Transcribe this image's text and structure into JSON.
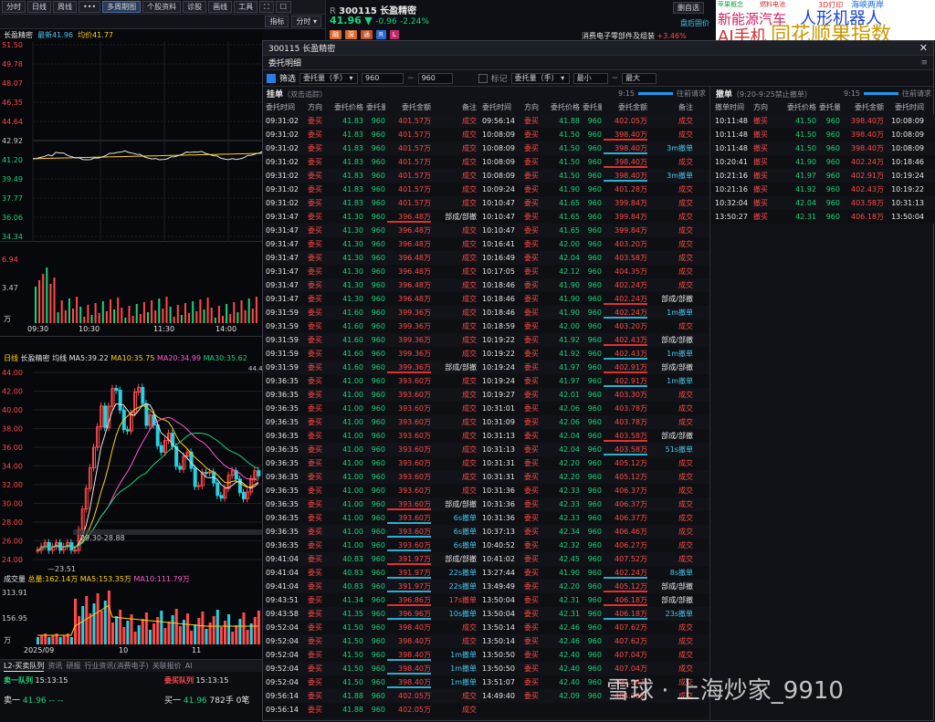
{
  "toolbar": {
    "items": [
      "分时",
      "日线",
      "周线",
      "•••",
      "多周期图",
      "个股资料",
      "诊股",
      "画线",
      "工具",
      "⛶",
      "☐"
    ],
    "row2": [
      "指标",
      "分时"
    ]
  },
  "quote": {
    "prefix": "R",
    "code": "300115",
    "name": "长盈精密",
    "price": "41.96",
    "change": "-0.96",
    "pct": "-2.24%",
    "btn1": "删自选",
    "btn2": "盘后固价",
    "sector_text": "消费电子零部件及组装",
    "sector_pct": "+3.46%",
    "tags": [
      "融",
      "深",
      "通",
      "R",
      "L"
    ]
  },
  "themes": {
    "items": [
      "苹果概念",
      "燃料电池",
      "3D打印",
      "海峡两岸",
      "新能源汽车",
      "人形机器人",
      "AI手机",
      "同花顺果指数"
    ],
    "colors": [
      "#1ba34b",
      "#d72c2c",
      "#d72c2c",
      "#1a6dd8",
      "#cc2266",
      "#1a44cc",
      "#d72c2c",
      "#cc9900"
    ]
  },
  "left": {
    "minute_header": {
      "name": "长盈精密",
      "latest_label": "最新",
      "latest": "41.96",
      "avg_label": "均价",
      "avg": "41.77"
    },
    "price_axis": [
      "51.50",
      "49.78",
      "48.07",
      "46.35",
      "44.64",
      "42.92",
      "41.20",
      "39.49",
      "37.77",
      "36.06",
      "34.34"
    ],
    "vol_axis": [
      "6.94",
      "3.47",
      "万"
    ],
    "time_axis": [
      "09:30",
      "10:30",
      "11:30",
      "14:00"
    ],
    "kline_header": {
      "type": "日线",
      "name": "长盈精密",
      "avg_line": "均线",
      "ma5": "MA5:39.22",
      "ma10": "MA10:35.75",
      "ma20": "MA20:34.99",
      "ma30": "MA30:35.62"
    },
    "kline_axis": [
      "44.00",
      "42.00",
      "40.00",
      "38.00",
      "36.00",
      "34.00",
      "32.00",
      "30.00",
      "28.00",
      "26.00",
      "24.00"
    ],
    "kline_annotations": {
      "high": "44.4",
      "range": "29.30-28.88",
      "low": "23.51"
    },
    "volume_header": {
      "label": "成交量",
      "total": "总量:162.14万",
      "ma5": "MA5:153.35万",
      "ma10": "MA10:111.79万"
    },
    "volume_axis": [
      "313.91",
      "156.95",
      "万"
    ],
    "date_axis": [
      "2025/09",
      "10",
      "11"
    ],
    "bottom_tabs": [
      "L2-买卖队列",
      "资讯",
      "研报",
      "行业资讯(消费电子)",
      "关联报价",
      "AI"
    ],
    "sell_queue": {
      "label": "卖一队列",
      "time": "15:13:15",
      "level": "卖一",
      "price": "41.96",
      "qty": "-- --"
    },
    "buy_queue": {
      "label": "委买队列",
      "time": "15:13:15",
      "level": "买一",
      "price": "41.96",
      "qty": "782手",
      "tail": "0笔"
    }
  },
  "modal": {
    "title": "300115 长盈精密",
    "subtitle": "委托明细",
    "filter": {
      "filter_label": "筛选",
      "field": "委托量（手）",
      "from": "960",
      "to": "960",
      "mark_label": "标记",
      "field2": "委托量（手）",
      "min": "最小",
      "max": "最大"
    },
    "main": {
      "title": "挂单",
      "subtitle": "（双击追踪）",
      "time": "9:15",
      "link": "往前请求",
      "headers": [
        "委托时间",
        "方向",
        "委托价格",
        "委托量",
        "委托金额",
        "备注"
      ],
      "left_rows": [
        [
          "09:31:02",
          "委买",
          "41.83",
          "960",
          "401.57万",
          "成交",
          ""
        ],
        [
          "09:31:02",
          "委买",
          "41.83",
          "960",
          "401.57万",
          "成交",
          ""
        ],
        [
          "09:31:02",
          "委买",
          "41.83",
          "960",
          "401.57万",
          "成交",
          ""
        ],
        [
          "09:31:02",
          "委买",
          "41.83",
          "960",
          "401.57万",
          "成交",
          ""
        ],
        [
          "09:31:02",
          "委买",
          "41.83",
          "960",
          "401.57万",
          "成交",
          ""
        ],
        [
          "09:31:02",
          "委买",
          "41.83",
          "960",
          "401.57万",
          "成交",
          ""
        ],
        [
          "09:31:02",
          "委买",
          "41.83",
          "960",
          "401.57万",
          "成交",
          ""
        ],
        [
          "09:31:47",
          "委买",
          "41.30",
          "960",
          "396.48万",
          "部成/部撤",
          "r"
        ],
        [
          "09:31:47",
          "委买",
          "41.30",
          "960",
          "396.48万",
          "成交",
          ""
        ],
        [
          "09:31:47",
          "委买",
          "41.30",
          "960",
          "396.48万",
          "成交",
          ""
        ],
        [
          "09:31:47",
          "委买",
          "41.30",
          "960",
          "396.48万",
          "成交",
          ""
        ],
        [
          "09:31:47",
          "委买",
          "41.30",
          "960",
          "396.48万",
          "成交",
          ""
        ],
        [
          "09:31:47",
          "委买",
          "41.30",
          "960",
          "396.48万",
          "成交",
          ""
        ],
        [
          "09:31:47",
          "委买",
          "41.30",
          "960",
          "396.48万",
          "成交",
          ""
        ],
        [
          "09:31:59",
          "委买",
          "41.60",
          "960",
          "399.36万",
          "成交",
          ""
        ],
        [
          "09:31:59",
          "委买",
          "41.60",
          "960",
          "399.36万",
          "成交",
          ""
        ],
        [
          "09:31:59",
          "委买",
          "41.60",
          "960",
          "399.36万",
          "成交",
          ""
        ],
        [
          "09:31:59",
          "委买",
          "41.60",
          "960",
          "399.36万",
          "成交",
          ""
        ],
        [
          "09:31:59",
          "委买",
          "41.60",
          "960",
          "399.36万",
          "部成/部撤",
          "r"
        ],
        [
          "09:36:35",
          "委买",
          "41.00",
          "960",
          "393.60万",
          "成交",
          ""
        ],
        [
          "09:36:35",
          "委买",
          "41.00",
          "960",
          "393.60万",
          "成交",
          ""
        ],
        [
          "09:36:35",
          "委买",
          "41.00",
          "960",
          "393.60万",
          "成交",
          ""
        ],
        [
          "09:36:35",
          "委买",
          "41.00",
          "960",
          "393.60万",
          "成交",
          ""
        ],
        [
          "09:36:35",
          "委买",
          "41.00",
          "960",
          "393.60万",
          "成交",
          ""
        ],
        [
          "09:36:35",
          "委买",
          "41.00",
          "960",
          "393.60万",
          "成交",
          ""
        ],
        [
          "09:36:35",
          "委买",
          "41.00",
          "960",
          "393.60万",
          "成交",
          ""
        ],
        [
          "09:36:35",
          "委买",
          "41.00",
          "960",
          "393.60万",
          "成交",
          ""
        ],
        [
          "09:36:35",
          "委买",
          "41.00",
          "960",
          "393.60万",
          "成交",
          ""
        ],
        [
          "09:36:35",
          "委买",
          "41.00",
          "960",
          "393.60万",
          "部成/部撤",
          "r"
        ],
        [
          "09:36:35",
          "委买",
          "41.00",
          "960",
          "393.60万",
          "6s撤单",
          "b"
        ],
        [
          "09:36:35",
          "委买",
          "41.00",
          "960",
          "393.60万",
          "6s撤单",
          "b"
        ],
        [
          "09:36:35",
          "委买",
          "41.00",
          "960",
          "393.60万",
          "6s撤单",
          "b"
        ],
        [
          "09:41:04",
          "委买",
          "40.83",
          "960",
          "391.97万",
          "部成/部撤",
          "r"
        ],
        [
          "09:41:04",
          "委买",
          "40.83",
          "960",
          "391.97万",
          "22s撤单",
          "b"
        ],
        [
          "09:41:04",
          "委买",
          "40.83",
          "960",
          "391.97万",
          "22s撤单",
          "b"
        ],
        [
          "09:43:51",
          "委买",
          "41.34",
          "960",
          "396.86万",
          "17s撤单",
          "r"
        ],
        [
          "09:43:58",
          "委买",
          "41.35",
          "960",
          "396.96万",
          "10s撤单",
          "b"
        ],
        [
          "09:52:04",
          "委买",
          "41.50",
          "960",
          "398.40万",
          "成交",
          ""
        ],
        [
          "09:52:04",
          "委买",
          "41.50",
          "960",
          "398.40万",
          "成交",
          ""
        ],
        [
          "09:52:04",
          "委买",
          "41.50",
          "960",
          "398.40万",
          "1m撤单",
          "b"
        ],
        [
          "09:52:04",
          "委买",
          "41.50",
          "960",
          "398.40万",
          "1m撤单",
          "b"
        ],
        [
          "09:52:04",
          "委买",
          "41.50",
          "960",
          "398.40万",
          "1m撤单",
          "b"
        ],
        [
          "09:56:14",
          "委买",
          "41.88",
          "960",
          "402.05万",
          "成交",
          ""
        ],
        [
          "09:56:14",
          "委买",
          "41.88",
          "960",
          "402.05万",
          "成交",
          ""
        ]
      ],
      "right_rows": [
        [
          "09:56:14",
          "委买",
          "41.88",
          "960",
          "402.05万",
          "成交",
          ""
        ],
        [
          "10:08:09",
          "委买",
          "41.50",
          "960",
          "398.40万",
          "成交",
          "r"
        ],
        [
          "10:08:09",
          "委买",
          "41.50",
          "960",
          "398.40万",
          "3m撤单",
          "b"
        ],
        [
          "10:08:09",
          "委买",
          "41.50",
          "960",
          "398.40万",
          "成交",
          "r"
        ],
        [
          "10:08:09",
          "委买",
          "41.50",
          "960",
          "398.40万",
          "3m撤单",
          "b"
        ],
        [
          "10:09:24",
          "委买",
          "41.90",
          "960",
          "401.28万",
          "成交",
          ""
        ],
        [
          "10:10:47",
          "委买",
          "41.65",
          "960",
          "399.84万",
          "成交",
          ""
        ],
        [
          "10:10:47",
          "委买",
          "41.65",
          "960",
          "399.84万",
          "成交",
          ""
        ],
        [
          "10:10:47",
          "委买",
          "41.65",
          "960",
          "399.84万",
          "成交",
          ""
        ],
        [
          "10:16:41",
          "委买",
          "42.00",
          "960",
          "403.20万",
          "成交",
          ""
        ],
        [
          "10:16:49",
          "委买",
          "42.04",
          "960",
          "403.58万",
          "成交",
          ""
        ],
        [
          "10:17:05",
          "委买",
          "42.12",
          "960",
          "404.35万",
          "成交",
          ""
        ],
        [
          "10:18:46",
          "委买",
          "41.90",
          "960",
          "402.24万",
          "成交",
          ""
        ],
        [
          "10:18:46",
          "委买",
          "41.90",
          "960",
          "402.24万",
          "部成/部撤",
          "r"
        ],
        [
          "10:18:46",
          "委买",
          "41.90",
          "960",
          "402.24万",
          "1m撤单",
          "b"
        ],
        [
          "10:18:59",
          "委买",
          "42.00",
          "960",
          "403.20万",
          "成交",
          ""
        ],
        [
          "10:19:22",
          "委买",
          "41.92",
          "960",
          "402.43万",
          "部成/部撤",
          "r"
        ],
        [
          "10:19:22",
          "委买",
          "41.92",
          "960",
          "402.43万",
          "1m撤单",
          "b"
        ],
        [
          "10:19:24",
          "委买",
          "41.97",
          "960",
          "402.91万",
          "部成/部撤",
          "r"
        ],
        [
          "10:19:24",
          "委买",
          "41.97",
          "960",
          "402.91万",
          "1m撤单",
          "b"
        ],
        [
          "10:19:27",
          "委买",
          "42.01",
          "960",
          "403.30万",
          "成交",
          ""
        ],
        [
          "10:31:01",
          "委买",
          "42.06",
          "960",
          "403.78万",
          "成交",
          ""
        ],
        [
          "10:31:09",
          "委买",
          "42.06",
          "960",
          "403.78万",
          "成交",
          ""
        ],
        [
          "10:31:13",
          "委买",
          "42.04",
          "960",
          "403.58万",
          "部成/部撤",
          "r"
        ],
        [
          "10:31:13",
          "委买",
          "42.04",
          "960",
          "403.58万",
          "51s撤单",
          "b"
        ],
        [
          "10:31:31",
          "委买",
          "42.20",
          "960",
          "405.12万",
          "成交",
          ""
        ],
        [
          "10:31:31",
          "委买",
          "42.20",
          "960",
          "405.12万",
          "成交",
          ""
        ],
        [
          "10:31:36",
          "委买",
          "42.33",
          "960",
          "406.37万",
          "成交",
          ""
        ],
        [
          "10:31:36",
          "委买",
          "42.33",
          "960",
          "406.37万",
          "成交",
          ""
        ],
        [
          "10:31:36",
          "委买",
          "42.33",
          "960",
          "406.37万",
          "成交",
          ""
        ],
        [
          "10:37:13",
          "委买",
          "42.34",
          "960",
          "406.46万",
          "成交",
          ""
        ],
        [
          "10:40:52",
          "委买",
          "42.32",
          "960",
          "406.27万",
          "成交",
          ""
        ],
        [
          "10:41:02",
          "委买",
          "42.45",
          "960",
          "407.52万",
          "成交",
          ""
        ],
        [
          "13:27:44",
          "委买",
          "41.90",
          "960",
          "402.24万",
          "8s撤单",
          "b"
        ],
        [
          "13:49:49",
          "委买",
          "42.20",
          "960",
          "405.12万",
          "部成/部撤",
          "r"
        ],
        [
          "13:50:04",
          "委买",
          "42.31",
          "960",
          "406.18万",
          "部成/部撤",
          "r"
        ],
        [
          "13:50:04",
          "委买",
          "42.31",
          "960",
          "406.18万",
          "23s撤单",
          "b"
        ],
        [
          "13:50:14",
          "委买",
          "42.46",
          "960",
          "407.62万",
          "成交",
          ""
        ],
        [
          "13:50:14",
          "委买",
          "42.46",
          "960",
          "407.62万",
          "成交",
          ""
        ],
        [
          "13:50:50",
          "委买",
          "42.40",
          "960",
          "407.04万",
          "成交",
          ""
        ],
        [
          "13:50:50",
          "委买",
          "42.40",
          "960",
          "407.04万",
          "成交",
          ""
        ],
        [
          "13:51:07",
          "委买",
          "42.40",
          "960",
          "407.04万",
          "成交",
          ""
        ],
        [
          "14:49:40",
          "委买",
          "42.09",
          "960",
          "404.06万",
          "成交",
          ""
        ],
        [
          "",
          "",
          "",
          "",
          "",
          "",
          ""
        ]
      ]
    },
    "cancel": {
      "title": "撤单",
      "subtitle": "（9:20-9:25禁止撤单）",
      "time": "9:15",
      "link": "往前请求",
      "headers": [
        "撤单时间",
        "方向",
        "委托价格",
        "委托量",
        "委托金额",
        "委托时间"
      ],
      "rows": [
        [
          "10:11:48",
          "撤买",
          "41.50",
          "960",
          "398.40万",
          "10:08:09"
        ],
        [
          "10:11:48",
          "撤买",
          "41.50",
          "960",
          "398.40万",
          "10:08:09"
        ],
        [
          "10:11:48",
          "撤买",
          "41.50",
          "960",
          "398.40万",
          "10:08:09"
        ],
        [
          "10:20:41",
          "撤买",
          "41.90",
          "960",
          "402.24万",
          "10:18:46"
        ],
        [
          "10:21:16",
          "撤买",
          "41.97",
          "960",
          "402.91万",
          "10:19:24"
        ],
        [
          "10:21:16",
          "撤买",
          "41.92",
          "960",
          "402.43万",
          "10:19:22"
        ],
        [
          "10:32:04",
          "撤买",
          "42.04",
          "960",
          "403.58万",
          "10:31:13"
        ],
        [
          "13:50:27",
          "撤买",
          "42.31",
          "960",
          "406.18万",
          "13:50:04"
        ]
      ]
    }
  },
  "watermark": "雪球 · 上海炒家_9910"
}
